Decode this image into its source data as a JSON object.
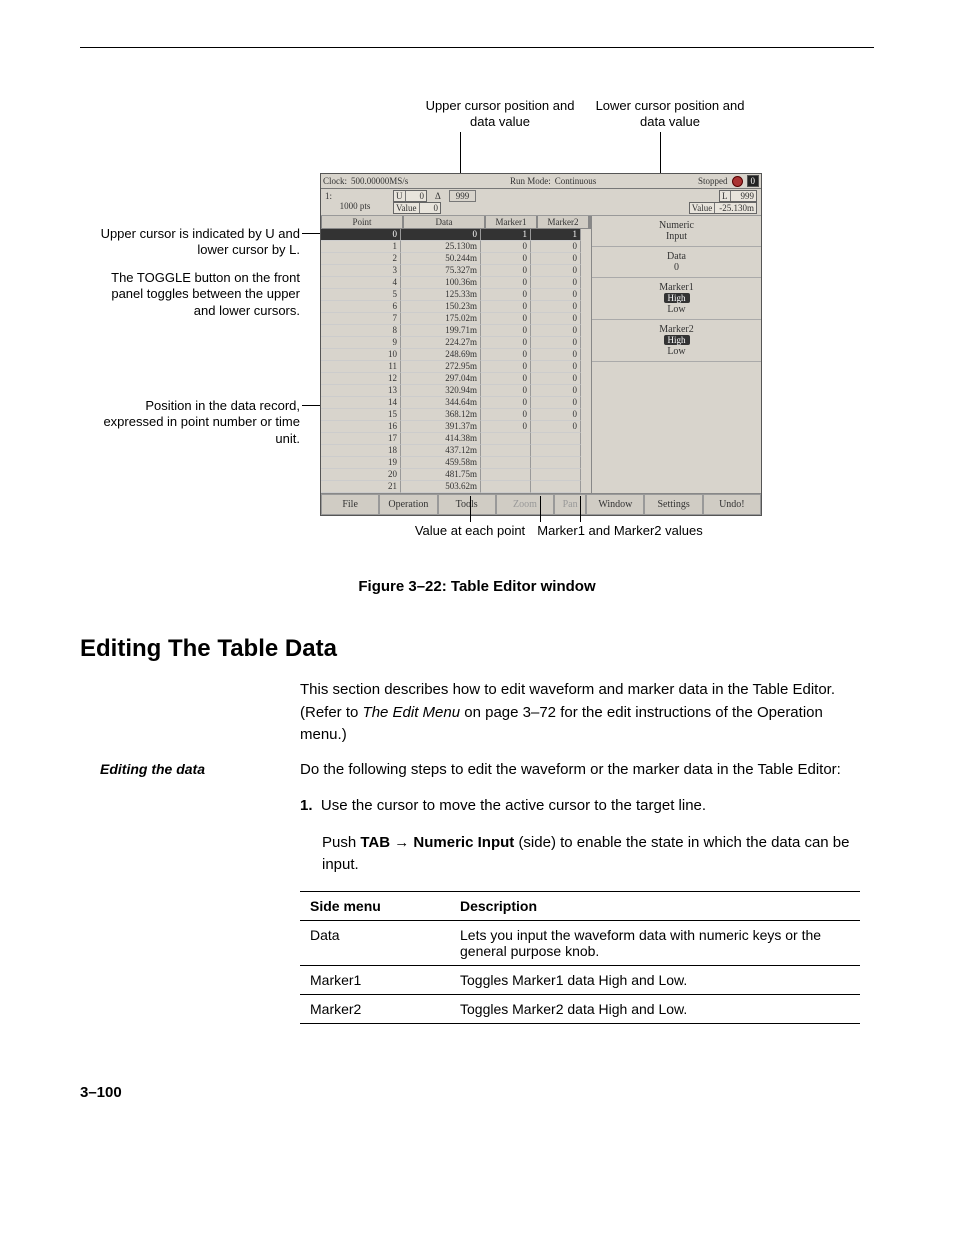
{
  "callouts": {
    "upper_pos": "Upper cursor position\nand data value",
    "lower_pos": "Lower cursor position\nand data value",
    "cursor_ind": "Upper cursor is indicated by U\nand lower cursor by L.",
    "toggle_btn": "The TOGGLE button on the\nfront panel toggles between\nthe upper and lower cursors.",
    "position_rec": "Position in the data\nrecord, expressed in point\nnumber or time unit.",
    "value_each": "Value at each point",
    "marker_vals": "Marker1 and Marker2 values"
  },
  "ui": {
    "clock_label": "Clock:",
    "clock_value": "500.00000MS/s",
    "runmode_label": "Run Mode:",
    "runmode_value": "Continuous",
    "status": "Stopped",
    "zero_badge": "0",
    "file_label": "1:",
    "pts": "1000 pts",
    "u_label": "U",
    "u_val": "0",
    "u_value_label": "Value",
    "u_value_val": "0",
    "delta": "Δ",
    "delta_val": "999",
    "l_label": "L",
    "l_val": "999",
    "l_value_label": "Value",
    "l_value_val": "-25.130m",
    "hdr_point": "Point",
    "hdr_data": "Data",
    "hdr_m1": "Marker1",
    "hdr_m2": "Marker2",
    "rows": [
      {
        "pt": "0",
        "dt": "0",
        "m1": "1",
        "m2": "1",
        "hl": true
      },
      {
        "pt": "1",
        "dt": "25.130m",
        "m1": "0",
        "m2": "0"
      },
      {
        "pt": "2",
        "dt": "50.244m",
        "m1": "0",
        "m2": "0"
      },
      {
        "pt": "3",
        "dt": "75.327m",
        "m1": "0",
        "m2": "0"
      },
      {
        "pt": "4",
        "dt": "100.36m",
        "m1": "0",
        "m2": "0"
      },
      {
        "pt": "5",
        "dt": "125.33m",
        "m1": "0",
        "m2": "0"
      },
      {
        "pt": "6",
        "dt": "150.23m",
        "m1": "0",
        "m2": "0"
      },
      {
        "pt": "7",
        "dt": "175.02m",
        "m1": "0",
        "m2": "0"
      },
      {
        "pt": "8",
        "dt": "199.71m",
        "m1": "0",
        "m2": "0"
      },
      {
        "pt": "9",
        "dt": "224.27m",
        "m1": "0",
        "m2": "0"
      },
      {
        "pt": "10",
        "dt": "248.69m",
        "m1": "0",
        "m2": "0"
      },
      {
        "pt": "11",
        "dt": "272.95m",
        "m1": "0",
        "m2": "0"
      },
      {
        "pt": "12",
        "dt": "297.04m",
        "m1": "0",
        "m2": "0"
      },
      {
        "pt": "13",
        "dt": "320.94m",
        "m1": "0",
        "m2": "0"
      },
      {
        "pt": "14",
        "dt": "344.64m",
        "m1": "0",
        "m2": "0"
      },
      {
        "pt": "15",
        "dt": "368.12m",
        "m1": "0",
        "m2": "0"
      },
      {
        "pt": "16",
        "dt": "391.37m",
        "m1": "0",
        "m2": "0"
      },
      {
        "pt": "17",
        "dt": "414.38m",
        "m1": "",
        "m2": ""
      },
      {
        "pt": "18",
        "dt": "437.12m",
        "m1": "",
        "m2": ""
      },
      {
        "pt": "19",
        "dt": "459.58m",
        "m1": "",
        "m2": ""
      },
      {
        "pt": "20",
        "dt": "481.75m",
        "m1": "",
        "m2": ""
      },
      {
        "pt": "21",
        "dt": "503.62m",
        "m1": "",
        "m2": ""
      }
    ],
    "right": {
      "numeric": "Numeric\nInput",
      "data": "Data",
      "data_val": "0",
      "m1": "Marker1",
      "high": "High",
      "low": "Low",
      "m2": "Marker2"
    },
    "menu": {
      "file": "File",
      "operation": "Operation",
      "tools": "Tools",
      "zoom": "Zoom",
      "pan": "Pan",
      "window": "Window",
      "settings": "Settings",
      "undo": "Undo!"
    }
  },
  "caption": "Figure 3–22: Table Editor window",
  "section_title": "Editing The Table Data",
  "body": {
    "p1": "This section describes how to edit waveform and marker data in the Table Editor. (Refer to ",
    "p1_link": "The Edit Menu",
    "p1_after": " on page 3–72 for the edit instructions of the Operation menu.)",
    "p2": "Do the following steps to edit the waveform or the marker data in the Table Editor:",
    "step1": "Use the cursor to move the active cursor to the target line.",
    "step1b_a": "Push ",
    "step1b_b": "TAB",
    "step1b_c": " → ",
    "step1b_d": "Numeric Input",
    "step1b_e": " (side) to enable the state in which the data can be input.",
    "col_side": "Side menu",
    "col_desc": "Description",
    "row_data_label": "Data",
    "row_data_desc": "Lets you input the waveform data with numeric keys or the general purpose knob.",
    "row_m1_label": "Marker1",
    "row_m1_desc": "Toggles Marker1 data High and Low.",
    "row_m2_label": "Marker2",
    "row_m2_desc": "Toggles Marker2 data High and Low."
  },
  "editing_proc": "Editing the data",
  "page_num": "3–100"
}
